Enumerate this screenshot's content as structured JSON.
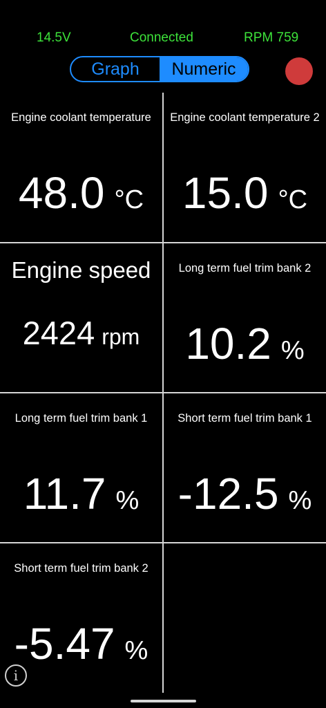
{
  "status": {
    "voltage": "14.5V",
    "connection": "Connected",
    "rpm": "RPM 759"
  },
  "view_toggle": {
    "graph_label": "Graph",
    "numeric_label": "Numeric",
    "selected": "Numeric"
  },
  "colors": {
    "status_green": "#3de23a",
    "accent_blue": "#1e8cff",
    "record_red": "#cf3b3b"
  },
  "record_button": {
    "icon": "record-dot-icon"
  },
  "cells": [
    {
      "label": "Engine coolant temperature",
      "value": "48.0",
      "unit": "°C"
    },
    {
      "label": "Engine coolant temperature 2",
      "value": "15.0",
      "unit": "°C"
    },
    {
      "label": "Engine speed",
      "value": "2424",
      "unit": "rpm"
    },
    {
      "label": "Long term fuel trim bank 2",
      "value": "10.2",
      "unit": "%"
    },
    {
      "label": "Long term fuel trim bank 1",
      "value": "11.7",
      "unit": "%"
    },
    {
      "label": "Short term fuel trim bank 1",
      "value": "-12.5",
      "unit": "%"
    },
    {
      "label": "Short term fuel trim bank 2",
      "value": "-5.47",
      "unit": "%"
    }
  ],
  "info_icon": {
    "glyph": "i"
  }
}
